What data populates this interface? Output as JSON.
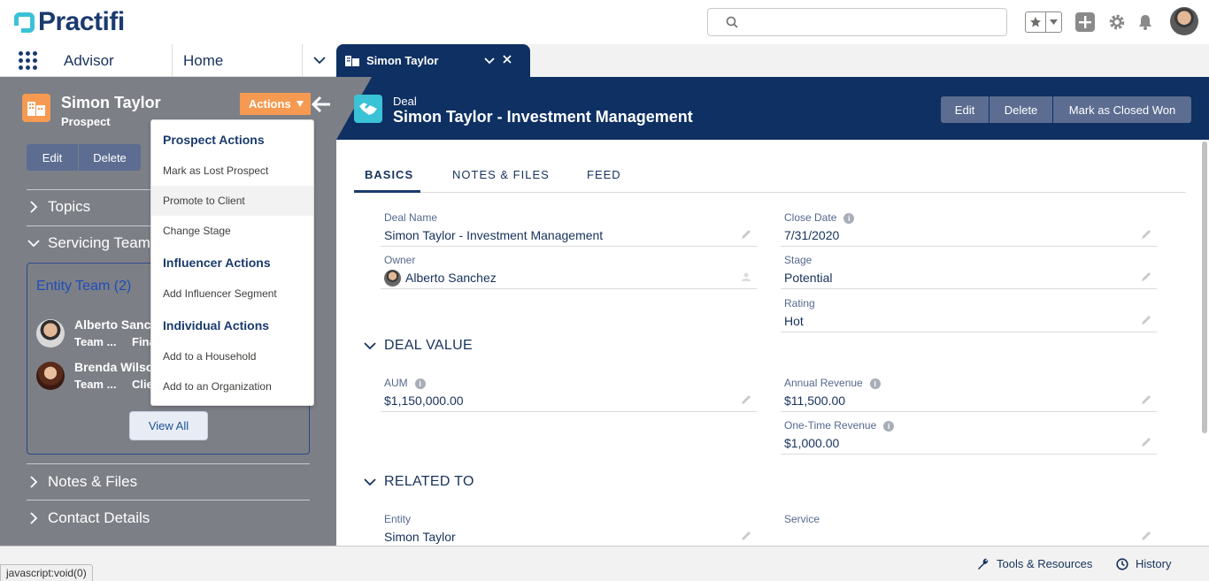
{
  "header": {
    "logo_text": "Practifi",
    "search_placeholder": ""
  },
  "nav": {
    "app_name": "Advisor",
    "home_label": "Home",
    "active_tab": "Simon Taylor"
  },
  "entity": {
    "name": "Simon Taylor",
    "type": "Prospect",
    "actions_label": "Actions",
    "edit_label": "Edit",
    "delete_label": "Delete"
  },
  "sections": {
    "topics": "Topics",
    "servicing_team": "Servicing Team",
    "notes_files": "Notes & Files",
    "contact_details": "Contact Details"
  },
  "team": {
    "title": "Entity Team (2)",
    "members": [
      {
        "name": "Alberto Sanchez",
        "role": "Team ...",
        "role2": "Financial Advisor"
      },
      {
        "name": "Brenda Wilson",
        "role": "Team ...",
        "role2": "Client Service"
      }
    ],
    "view_all": "View All"
  },
  "menu": {
    "prospect_head": "Prospect Actions",
    "mark_lost": "Mark as Lost Prospect",
    "promote": "Promote to Client",
    "change_stage": "Change Stage",
    "influencer_head": "Influencer Actions",
    "add_segment": "Add Influencer Segment",
    "individual_head": "Individual Actions",
    "add_household": "Add to a Household",
    "add_org": "Add to an Organization"
  },
  "record": {
    "type": "Deal",
    "title": "Simon Taylor - Investment Management",
    "buttons": {
      "edit": "Edit",
      "delete": "Delete",
      "closed_won": "Mark as Closed Won"
    },
    "tabs": {
      "basics": "BASICS",
      "notes": "NOTES & FILES",
      "feed": "FEED"
    },
    "fields": {
      "deal_name_label": "Deal Name",
      "deal_name": "Simon Taylor - Investment Management",
      "close_date_label": "Close Date",
      "close_date": "7/31/2020",
      "owner_label": "Owner",
      "owner": "Alberto Sanchez",
      "stage_label": "Stage",
      "stage": "Potential",
      "rating_label": "Rating",
      "rating": "Hot"
    },
    "deal_value": {
      "head": "DEAL VALUE",
      "aum_label": "AUM",
      "aum": "$1,150,000.00",
      "annual_label": "Annual Revenue",
      "annual": "$11,500.00",
      "onetime_label": "One-Time Revenue",
      "onetime": "$1,000.00"
    },
    "related": {
      "head": "RELATED TO",
      "entity_label": "Entity",
      "entity": "Simon Taylor",
      "service_label": "Service",
      "service": ""
    }
  },
  "footer": {
    "status_url": "javascript:void(0)",
    "tools": "Tools & Resources",
    "history": "History"
  },
  "colors": {
    "brand_navy": "#0e3063",
    "accent_orange": "#f59a50",
    "teal": "#3ac2d6",
    "panel_gray": "#7d7f87"
  }
}
